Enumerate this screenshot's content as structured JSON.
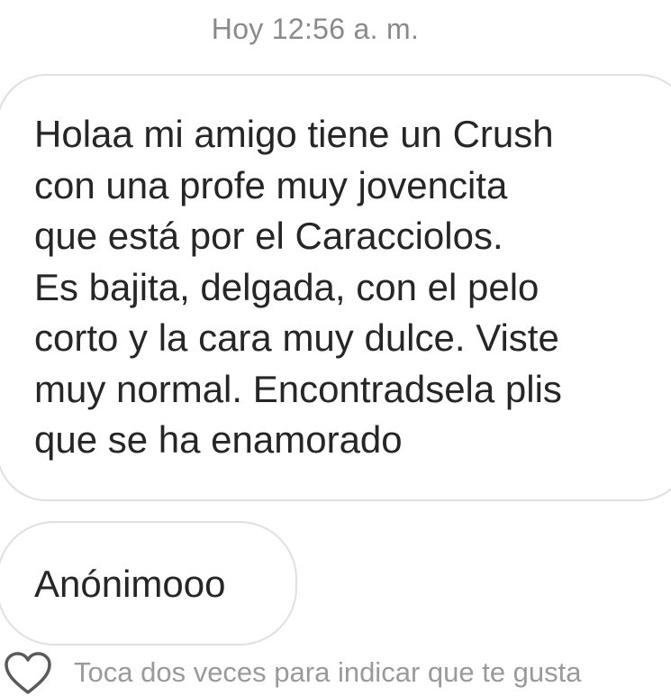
{
  "header": {
    "timestamp": "Hoy 12:56 a. m."
  },
  "message": {
    "text": "Holaa mi amigo tiene un Crush\ncon una profe muy jovencita\nque está por el Caracciolos.\nEs bajita, delgada, con el pelo\ncorto y la cara muy dulce. Viste\nmuy normal. Encontradsela plis\nque se ha enamorado"
  },
  "reply": {
    "text": "Anónimooo"
  },
  "footer": {
    "hint": "Toca dos veces para indicar que te gusta",
    "icon": "heart-icon"
  }
}
